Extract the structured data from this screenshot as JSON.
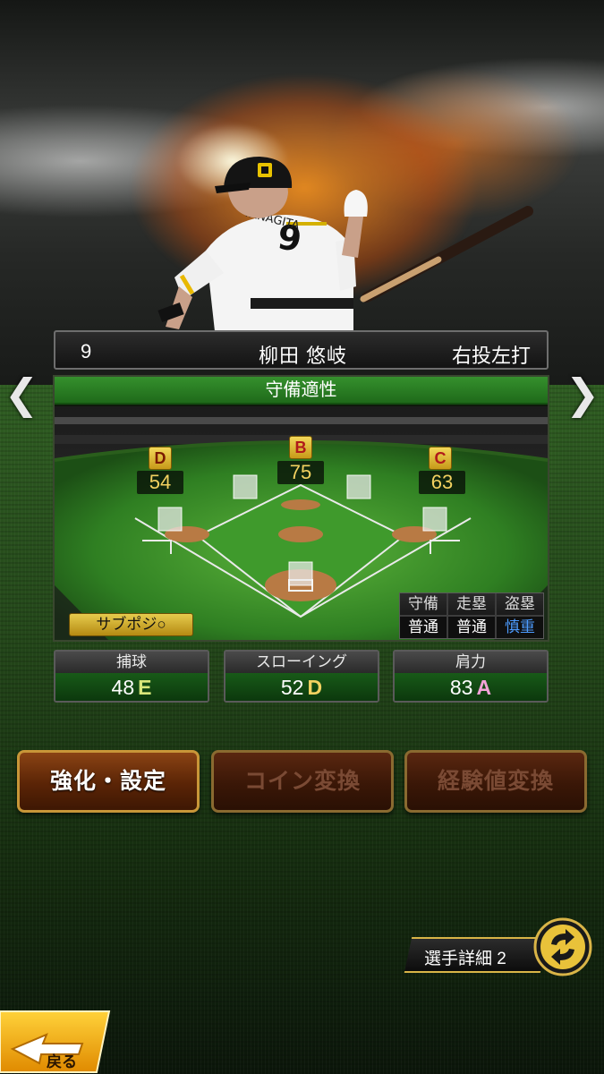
{
  "player": {
    "number": "9",
    "name": "柳田 悠岐",
    "handedness": "右投左打"
  },
  "defense": {
    "title": "守備適性",
    "positions": [
      {
        "grade": "D",
        "value": "54"
      },
      {
        "grade": "B",
        "value": "75"
      },
      {
        "grade": "C",
        "value": "63"
      }
    ],
    "sub_position": "サブポジ○",
    "running": {
      "headers": [
        "守備",
        "走塁",
        "盗塁"
      ],
      "values": [
        "普通",
        "普通",
        "慎重"
      ]
    }
  },
  "stats": [
    {
      "label": "捕球",
      "value": "48",
      "grade": "E",
      "grade_color": "#d8e67a"
    },
    {
      "label": "スローイング",
      "value": "52",
      "grade": "D",
      "grade_color": "#f2d160"
    },
    {
      "label": "肩力",
      "value": "83",
      "grade": "A",
      "grade_color": "#f3a3d8"
    }
  ],
  "actions": {
    "enhance": "強化・設定",
    "coin": "コイン変換",
    "exp": "経験値変換"
  },
  "detail": {
    "label": "選手詳細 2"
  },
  "back": {
    "label": "戻る"
  },
  "colors": {
    "gold": "#d9b447",
    "panel_green": "#2a7f24",
    "grade_blue": "#4d9cff"
  },
  "icons": {
    "prev": "chevron-left-icon",
    "next": "chevron-right-icon",
    "swap": "swap-icon",
    "back": "back-arrow-icon"
  }
}
